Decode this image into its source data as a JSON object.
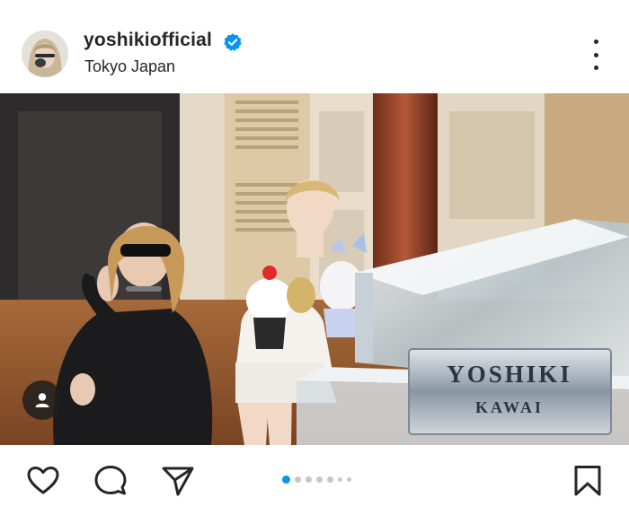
{
  "post": {
    "username": "yoshikiofficial",
    "location": "Tokyo Japan",
    "verified": true,
    "carousel": {
      "total_slides": 7,
      "current_slide": 1
    }
  },
  "photo": {
    "piano_brand_line1": "YOSHIKI",
    "piano_brand_line2": "KAWAI"
  },
  "icons": {
    "avatar": "avatar",
    "verified": "verified-badge-icon",
    "more": "more-options-icon",
    "tag": "user-tag-icon",
    "like": "heart-icon",
    "comment": "comment-icon",
    "share": "paper-plane-icon",
    "save": "bookmark-icon"
  },
  "colors": {
    "accent": "#0095f6",
    "text": "#262626",
    "dot_inactive": "#c7c7c7"
  }
}
